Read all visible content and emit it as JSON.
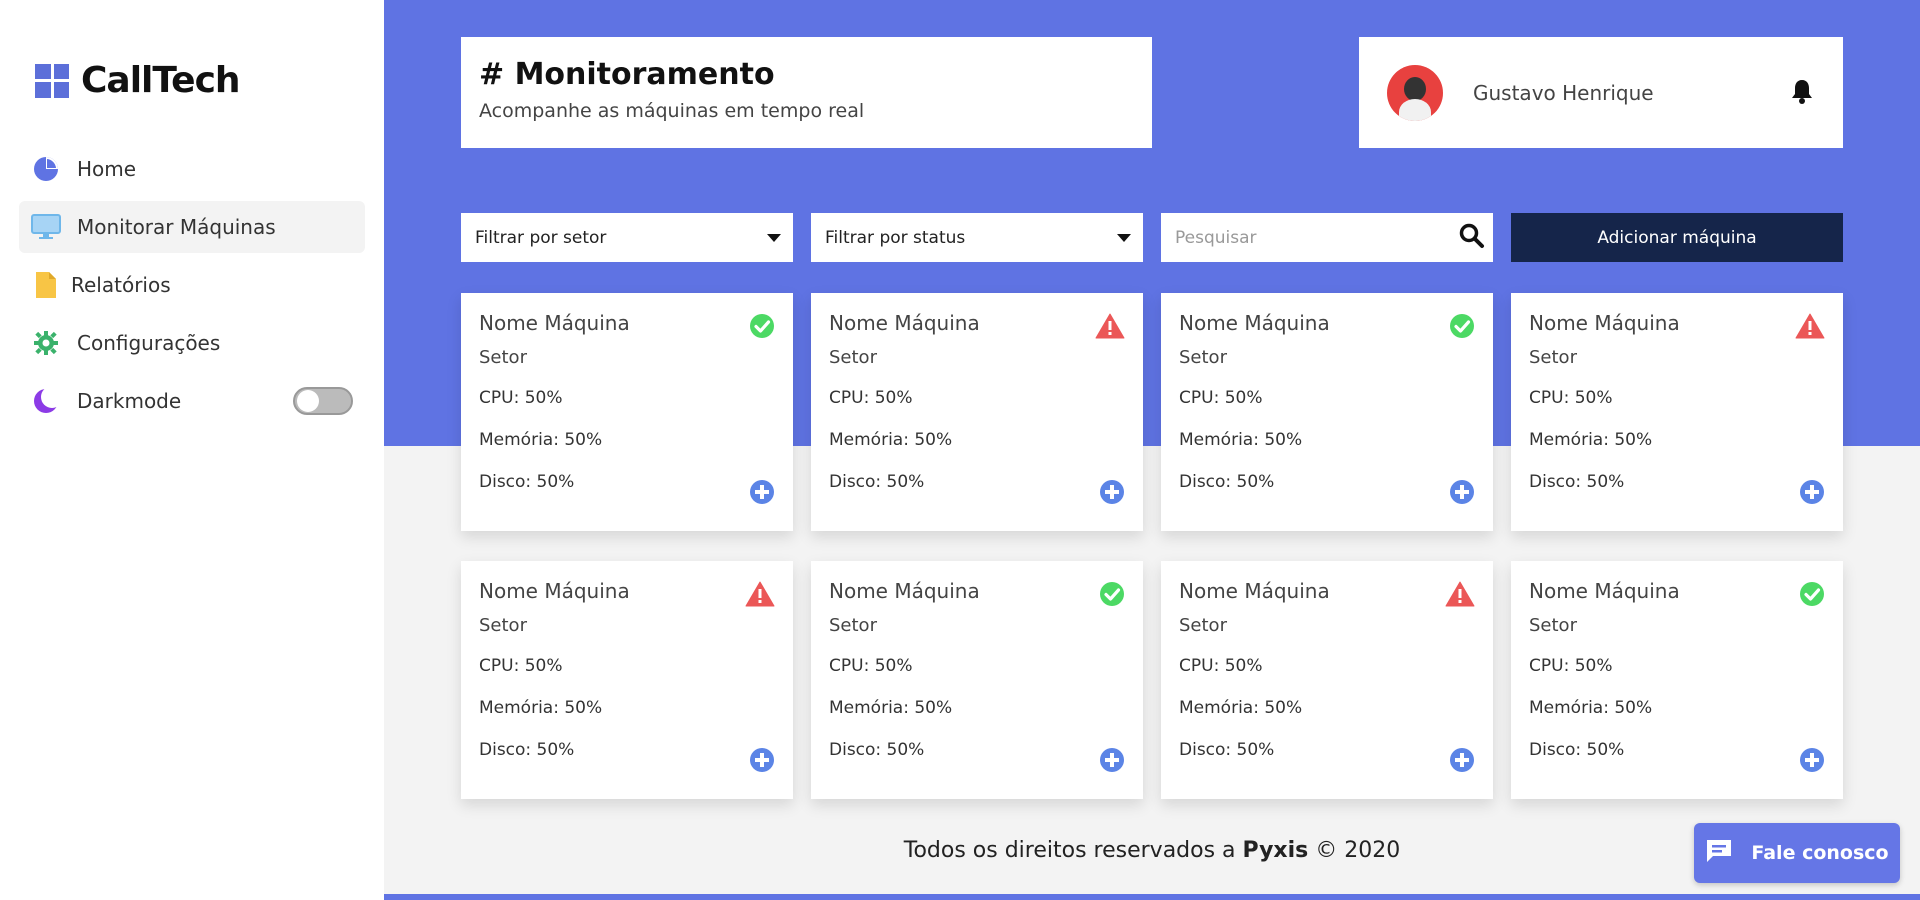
{
  "brand": {
    "name": "CallTech"
  },
  "sidebar": {
    "items": [
      {
        "label": "Home",
        "icon": "pie-chart-icon"
      },
      {
        "label": "Monitorar Máquinas",
        "icon": "monitor-icon"
      },
      {
        "label": "Relatórios",
        "icon": "file-icon"
      },
      {
        "label": "Configurações",
        "icon": "gear-icon"
      },
      {
        "label": "Darkmode",
        "icon": "moon-icon"
      }
    ],
    "active_index": 1
  },
  "header": {
    "title": "# Monitoramento",
    "subtitle": "Acompanhe as máquinas em tempo real"
  },
  "user": {
    "name": "Gustavo Henrique"
  },
  "filters": {
    "sector": "Filtrar por setor",
    "status": "Filtrar por status",
    "search_placeholder": "Pesquisar",
    "add_label": "Adicionar máquina"
  },
  "machines": [
    {
      "name": "Nome Máquina",
      "sector": "Setor",
      "cpu": "CPU: 50%",
      "memory": "Memória: 50%",
      "disk": "Disco: 50%",
      "status": "ok"
    },
    {
      "name": "Nome Máquina",
      "sector": "Setor",
      "cpu": "CPU: 50%",
      "memory": "Memória: 50%",
      "disk": "Disco: 50%",
      "status": "alert"
    },
    {
      "name": "Nome Máquina",
      "sector": "Setor",
      "cpu": "CPU: 50%",
      "memory": "Memória: 50%",
      "disk": "Disco: 50%",
      "status": "ok"
    },
    {
      "name": "Nome Máquina",
      "sector": "Setor",
      "cpu": "CPU: 50%",
      "memory": "Memória: 50%",
      "disk": "Disco: 50%",
      "status": "alert"
    },
    {
      "name": "Nome Máquina",
      "sector": "Setor",
      "cpu": "CPU: 50%",
      "memory": "Memória: 50%",
      "disk": "Disco: 50%",
      "status": "alert"
    },
    {
      "name": "Nome Máquina",
      "sector": "Setor",
      "cpu": "CPU: 50%",
      "memory": "Memória: 50%",
      "disk": "Disco: 50%",
      "status": "ok"
    },
    {
      "name": "Nome Máquina",
      "sector": "Setor",
      "cpu": "CPU: 50%",
      "memory": "Memória: 50%",
      "disk": "Disco: 50%",
      "status": "alert"
    },
    {
      "name": "Nome Máquina",
      "sector": "Setor",
      "cpu": "CPU: 50%",
      "memory": "Memória: 50%",
      "disk": "Disco: 50%",
      "status": "ok"
    }
  ],
  "footer": {
    "prefix": "Todos os direitos reservados a",
    "company": "Pyxis",
    "suffix": "© 2020"
  },
  "chat": {
    "label": "Fale conosco"
  },
  "colors": {
    "primary": "#5f73e3",
    "dark_button": "#15254a",
    "ok": "#4cd964",
    "alert": "#eb5757",
    "plus": "#5b84e6"
  }
}
